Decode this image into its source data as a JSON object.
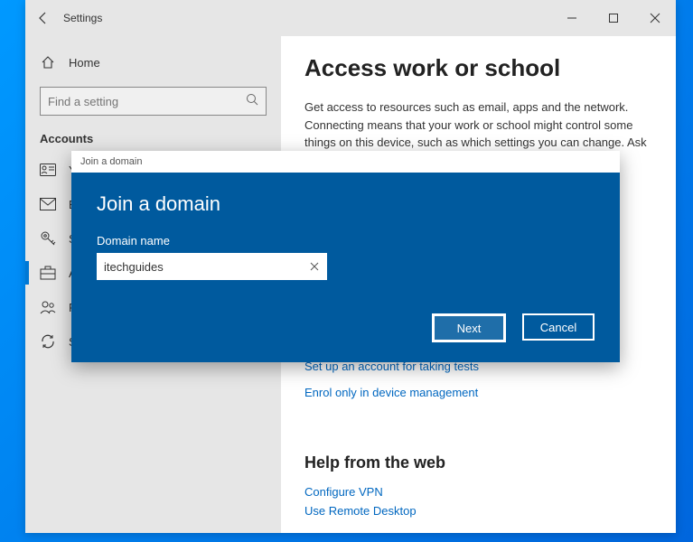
{
  "window": {
    "title": "Settings"
  },
  "sidebar": {
    "home_label": "Home",
    "search_placeholder": "Find a setting",
    "section": "Accounts",
    "items": [
      {
        "label": "Yo",
        "icon": "user-card-icon"
      },
      {
        "label": "En",
        "icon": "mail-icon"
      },
      {
        "label": "Si",
        "icon": "key-icon"
      },
      {
        "label": "A",
        "icon": "briefcase-icon",
        "active": true
      },
      {
        "label": "Fa",
        "icon": "people-icon"
      },
      {
        "label": "Sync your settings",
        "icon": "sync-icon"
      }
    ]
  },
  "main": {
    "heading": "Access work or school",
    "description": "Get access to resources such as email, apps and the network. Connecting means that your work or school might control some things on this device, such as which settings you can change. Ask",
    "link1": "Set up an account for taking tests",
    "link2": "Enrol only in device management",
    "help_heading": "Help from the web",
    "help_link1": "Configure VPN",
    "help_link2": "Use Remote Desktop"
  },
  "modal": {
    "title": "Join a domain",
    "heading": "Join a domain",
    "field_label": "Domain name",
    "domain_value": "itechguides",
    "next_label": "Next",
    "cancel_label": "Cancel"
  }
}
